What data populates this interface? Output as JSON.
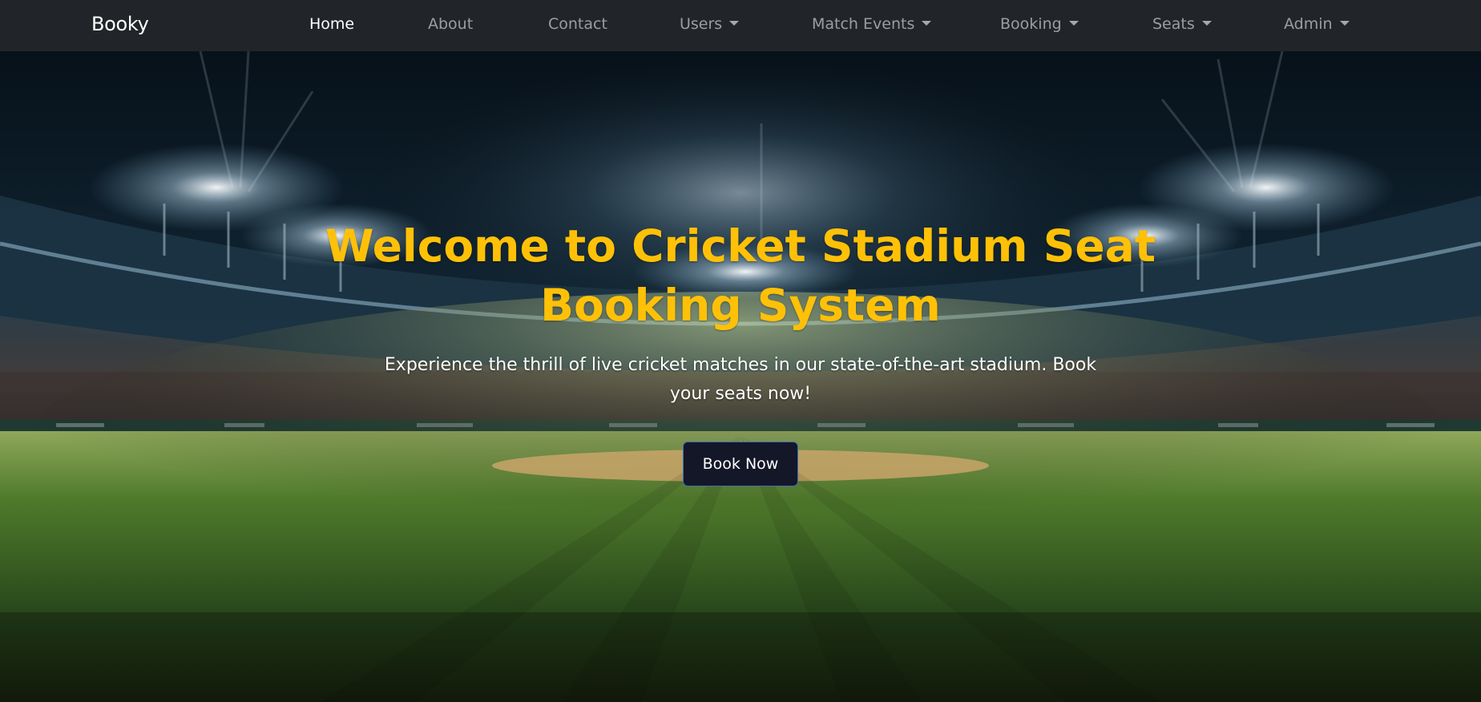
{
  "navbar": {
    "brand": "Booky",
    "items": [
      {
        "label": "Home",
        "active": true,
        "dropdown": false
      },
      {
        "label": "About",
        "active": false,
        "dropdown": false
      },
      {
        "label": "Contact",
        "active": false,
        "dropdown": false
      },
      {
        "label": "Users",
        "active": false,
        "dropdown": true
      },
      {
        "label": "Match Events",
        "active": false,
        "dropdown": true
      },
      {
        "label": "Booking",
        "active": false,
        "dropdown": true
      },
      {
        "label": "Seats",
        "active": false,
        "dropdown": true
      },
      {
        "label": "Admin",
        "active": false,
        "dropdown": true
      }
    ]
  },
  "hero": {
    "title": "Welcome to Cricket Stadium Seat Booking System",
    "subtitle": "Experience the thrill of live cricket matches in our state-of-the-art stadium. Book your seats now!",
    "button_label": "Book Now",
    "background_icon": "stadium-night-image"
  },
  "colors": {
    "navbar_bg": "#212529",
    "title": "#ffc107",
    "button_bg": "#141728",
    "button_border": "#3d6fb8"
  }
}
